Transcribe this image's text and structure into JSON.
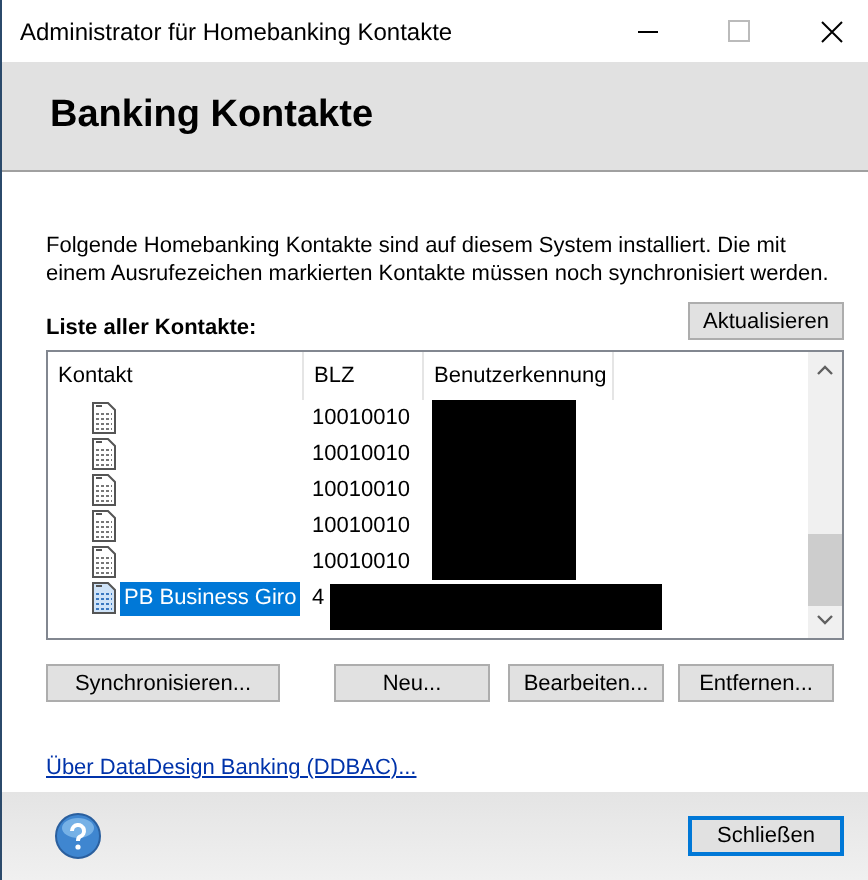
{
  "window": {
    "title": "Administrator für Homebanking Kontakte"
  },
  "header": {
    "title": "Banking Kontakte"
  },
  "description": "Folgende Homebanking Kontakte sind auf diesem System installiert. Die mit einem Ausrufezeichen markierten Kontakte müssen noch synchronisiert werden.",
  "list_label": "Liste aller Kontakte:",
  "refresh_button": "Aktualisieren",
  "table": {
    "columns": [
      "Kontakt",
      "BLZ",
      "Benutzerkennung"
    ],
    "rows": [
      {
        "contact": "",
        "blz": "10010010",
        "kind": "masked",
        "selected": false
      },
      {
        "contact": "",
        "blz": "10010010",
        "kind": "masked",
        "selected": false
      },
      {
        "contact": "",
        "blz": "10010010",
        "kind": "masked",
        "selected": false
      },
      {
        "contact": "",
        "blz": "10010010",
        "kind": "masked",
        "selected": false
      },
      {
        "contact": "",
        "blz": "10010010",
        "kind": "masked",
        "selected": false
      },
      {
        "contact": "PB Business Giro",
        "blz": "4",
        "kind": "widemasked",
        "selected": true
      }
    ]
  },
  "actions": [
    {
      "label": "Synchronisieren..."
    },
    {
      "label": "Neu..."
    },
    {
      "label": "Bearbeiten..."
    },
    {
      "label": "Entfernen..."
    }
  ],
  "about_link": "Über DataDesign Banking (DDBAC)...",
  "close_button": "Schließen"
}
